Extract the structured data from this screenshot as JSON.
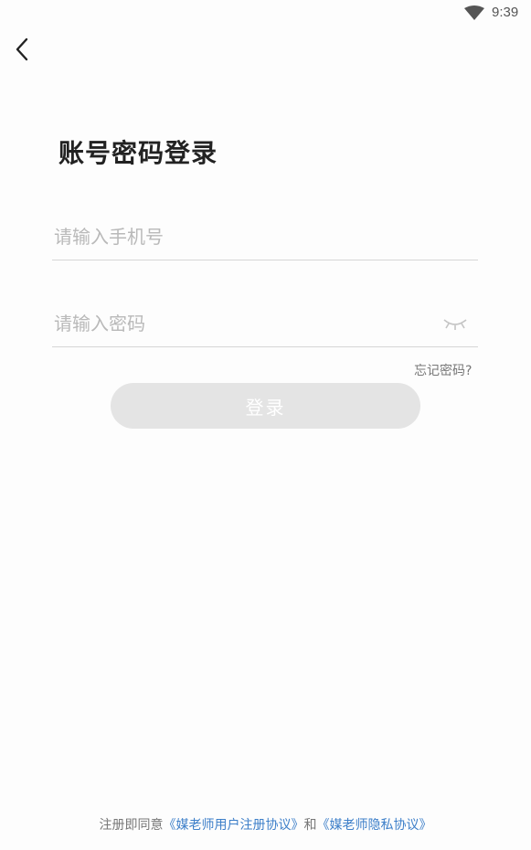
{
  "status_bar": {
    "time": "9:39",
    "wifi_icon": "wifi-icon"
  },
  "header": {
    "back_icon": "chevron-left-icon"
  },
  "main": {
    "title": "账号密码登录",
    "phone_input": {
      "placeholder": "请输入手机号",
      "value": ""
    },
    "password_input": {
      "placeholder": "请输入密码",
      "value": "",
      "toggle_icon": "eye-closed-icon"
    },
    "forgot_password": "忘记密码?",
    "login_button": "登录"
  },
  "footer": {
    "agreement_prefix": "注册即同意",
    "user_agreement": "《媒老师用户注册协议》",
    "conjunction": "和",
    "privacy_policy": "《媒老师隐私协议》"
  },
  "colors": {
    "link": "#3d7fc9",
    "button_disabled": "#e4e4e4",
    "placeholder": "#b9b9b9"
  }
}
